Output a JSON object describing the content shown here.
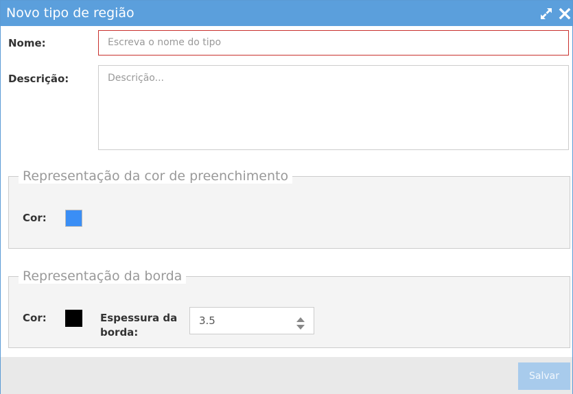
{
  "dialog": {
    "title": "Novo tipo de região",
    "expand_icon": "expand-arrows-icon",
    "close_icon": "close-icon"
  },
  "form": {
    "name_label": "Nome:",
    "name_placeholder": "Escreva o nome do tipo",
    "description_label": "Descrição:",
    "description_placeholder": "Descrição..."
  },
  "fill_section": {
    "legend": "Representação da cor de preenchimento",
    "color_label": "Cor:",
    "color_value": "#3a8ef5"
  },
  "border_section": {
    "legend": "Representação da borda",
    "color_label": "Cor:",
    "color_value": "#000000",
    "thickness_label_line1": "Espessura da",
    "thickness_label_line2": "borda:",
    "thickness_value": "3.5"
  },
  "footer": {
    "save_label": "Salvar"
  },
  "colors": {
    "titlebar": "#5b9fdc",
    "name_invalid_border": "#c9302c",
    "save_button": "#a8cbec"
  }
}
